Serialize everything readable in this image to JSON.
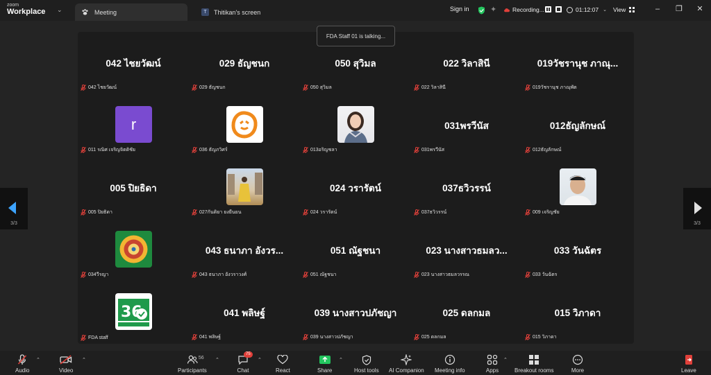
{
  "app": {
    "logo_line1": "zoom",
    "logo_line2": "Workplace"
  },
  "tabs": [
    {
      "label": "Meeting"
    },
    {
      "label": "Thitikan's screen",
      "badge": "T"
    }
  ],
  "header": {
    "signin": "Sign in",
    "recording": "Recording...",
    "timer": "01:12:07",
    "view": "View"
  },
  "toast": "FDA Staff 01 is talking...",
  "pager": {
    "left": "3/3",
    "right": "3/3"
  },
  "participants": [
    {
      "big": "042 ไชยวัฒน์",
      "label": "042 ไชยวัฒน์"
    },
    {
      "big": "029 ธัญชนก",
      "label": "029 ธัญชนก"
    },
    {
      "big": "050 สุวิมล",
      "label": "050 สุวิมล"
    },
    {
      "big": "022 วิลาสินี",
      "label": "022 วิลาสินี"
    },
    {
      "big": "019วัชรานุช ภาณุ...",
      "label": "019วัชรานุช ภาณุพัต"
    },
    {
      "avatar": "letter-r",
      "letter": "r",
      "label": "011 รณิศ เจริญจิตติชัย"
    },
    {
      "avatar": "orange-logo",
      "label": "036 ธัญภวิศร์"
    },
    {
      "avatar": "woman-photo",
      "label": "013อริญชลา"
    },
    {
      "big": "031พรวีนัส",
      "label": "031พรวีนัส"
    },
    {
      "big": "012ธัญลักษณ์",
      "label": "012ธัญลักษณ์"
    },
    {
      "big": "005 ปิยธิดา",
      "label": "005 ปิยธิดา"
    },
    {
      "avatar": "street-photo",
      "label": "027กันติยา ยงยืนยน"
    },
    {
      "big": "024 วรารัตน์",
      "label": "024 วรารัตน์"
    },
    {
      "big": "037ธวิวรรน์",
      "label": "037ธวิวรรน์"
    },
    {
      "avatar": "man-photo",
      "label": "009 เจริญชัย"
    },
    {
      "avatar": "green-emblem",
      "label": "034วีรญา"
    },
    {
      "big": "043 ธนาภา อังวร...",
      "label": "043 ธนาภา อังวราวงศ์"
    },
    {
      "big": "051 ณัฐชนา",
      "label": "051 ณัฐชนา"
    },
    {
      "big": "023 นางสาวธมลว...",
      "label": "023 นางสาวธมลวรรณ"
    },
    {
      "big": "033 วันฉัตร",
      "label": "033 วันฉัตร"
    },
    {
      "avatar": "fda-logo",
      "label": "FDA staff"
    },
    {
      "big": "041 พลิษฐ์",
      "label": "041 พลิษฐ์"
    },
    {
      "big": "039 นางสาวปภัชญา",
      "label": "039 นางสาวปภัชญา"
    },
    {
      "big": "025 ดลกมล",
      "label": "025 ดลกมล"
    },
    {
      "big": "015 วิภาดา",
      "label": "015 วิภาดา"
    }
  ],
  "toolbar": {
    "audio": "Audio",
    "video": "Video",
    "participants": "Participants",
    "participants_count": "56",
    "chat": "Chat",
    "chat_badge": "75",
    "react": "React",
    "share": "Share",
    "host_tools": "Host tools",
    "ai_companion": "AI Companion",
    "meeting_info": "Meeting info",
    "apps": "Apps",
    "breakout_rooms": "Breakout rooms",
    "more": "More",
    "leave": "Leave"
  },
  "colors": {
    "share_green": "#23c55e",
    "leave_red": "#e0403a",
    "muted_red": "#e0403a",
    "accent_blue": "#3da4ff"
  }
}
